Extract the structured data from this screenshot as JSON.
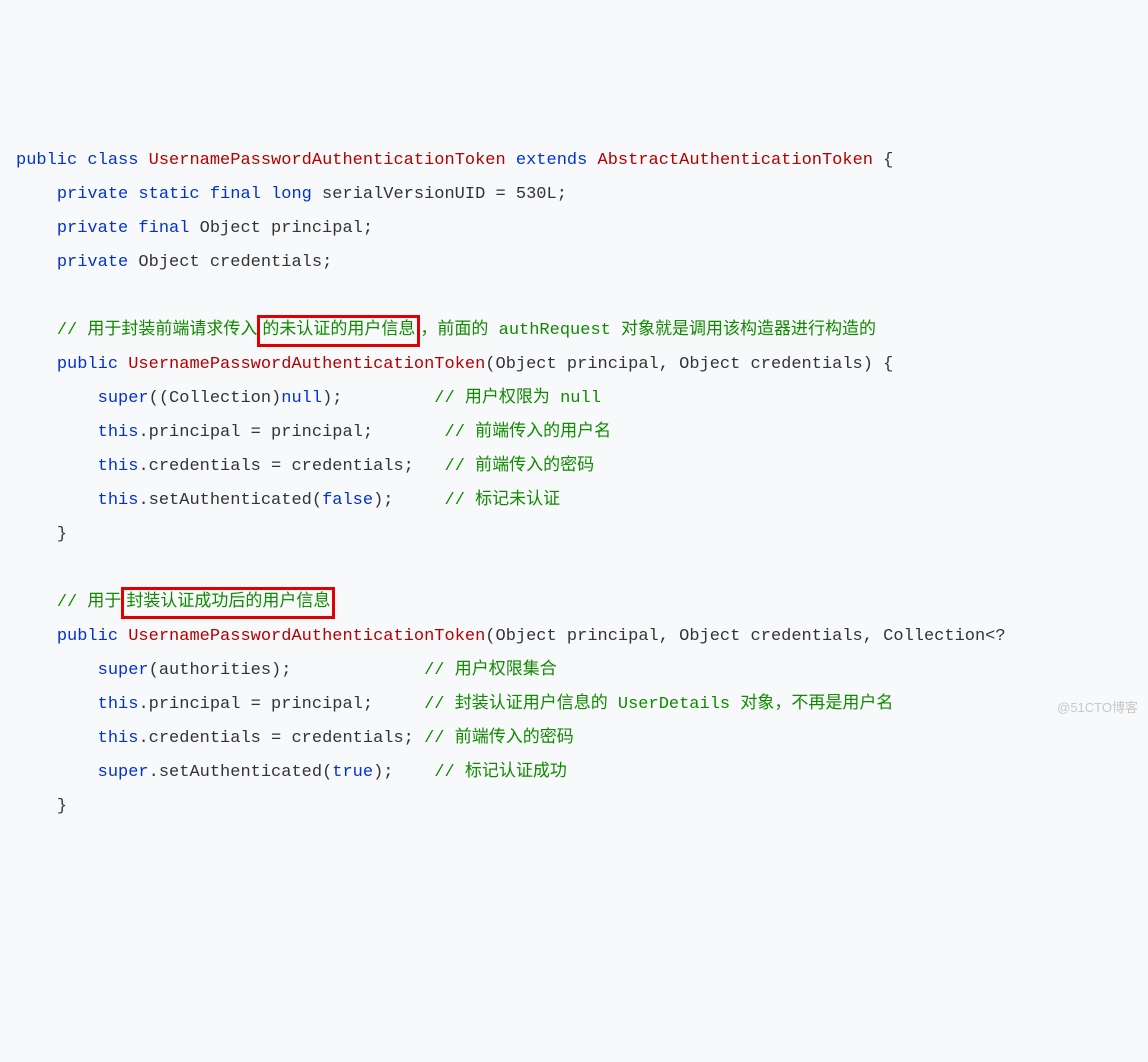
{
  "code": {
    "l1": {
      "kw1": "public",
      "kw2": "class",
      "cls": "UsernamePasswordAuthenticationToken",
      "kw3": "extends",
      "sup": "AbstractAuthenticationToken",
      "br": " {"
    },
    "l2": {
      "indent": "    ",
      "kw": "private static final long",
      "rest": " serialVersionUID = 530L;"
    },
    "l3": {
      "indent": "    ",
      "kw": "private final",
      "rest": " Object principal;"
    },
    "l4": {
      "indent": "    ",
      "kw": "private",
      "rest": " Object credentials;"
    },
    "l6": {
      "indent": "    ",
      "c_pre": "// 用于封装前端请求传入",
      "c_box": "的未认证的用户信息",
      "c_post": "，前面的 authRequest 对象就是调用该构造器进行构造的"
    },
    "l7": {
      "indent": "    ",
      "kw": "public",
      "name": "UsernamePasswordAuthenticationToken",
      "params": "(Object principal, Object credentials) {"
    },
    "l8": {
      "indent": "        ",
      "pre": "super",
      "mid": "((Collection)",
      "nul": "null",
      "post": ");         ",
      "cm": "// 用户权限为 null"
    },
    "l9": {
      "indent": "        ",
      "pre": "this",
      "mid": ".principal = principal;       ",
      "cm": "// 前端传入的用户名"
    },
    "l10": {
      "indent": "        ",
      "pre": "this",
      "mid": ".credentials = credentials;   ",
      "cm": "// 前端传入的密码"
    },
    "l11": {
      "indent": "        ",
      "pre": "this",
      "mid": ".setAuthenticated(",
      "val": "false",
      "post": ");     ",
      "cm": "// 标记未认证"
    },
    "l12": {
      "indent": "    ",
      "br": "}"
    },
    "l14": {
      "indent": "    ",
      "c_pre": "// 用于",
      "c_box": "封装认证成功后的用户信息"
    },
    "l15": {
      "indent": "    ",
      "kw": "public",
      "name": "UsernamePasswordAuthenticationToken",
      "params": "(Object principal, Object credentials, Collection<?"
    },
    "l16": {
      "indent": "        ",
      "pre": "super",
      "mid": "(authorities);             ",
      "cm": "// 用户权限集合"
    },
    "l17": {
      "indent": "        ",
      "pre": "this",
      "mid": ".principal = principal;     ",
      "cm": "// 封装认证用户信息的 UserDetails 对象，不再是用户名"
    },
    "l18": {
      "indent": "        ",
      "pre": "this",
      "mid": ".credentials = credentials; ",
      "cm": "// 前端传入的密码"
    },
    "l19": {
      "indent": "        ",
      "pre": "super",
      "mid": ".setAuthenticated(",
      "val": "true",
      "post": ");    ",
      "cm": "// 标记认证成功"
    },
    "l20": {
      "indent": "    ",
      "br": "}"
    }
  },
  "watermark": "@51CTO博客"
}
